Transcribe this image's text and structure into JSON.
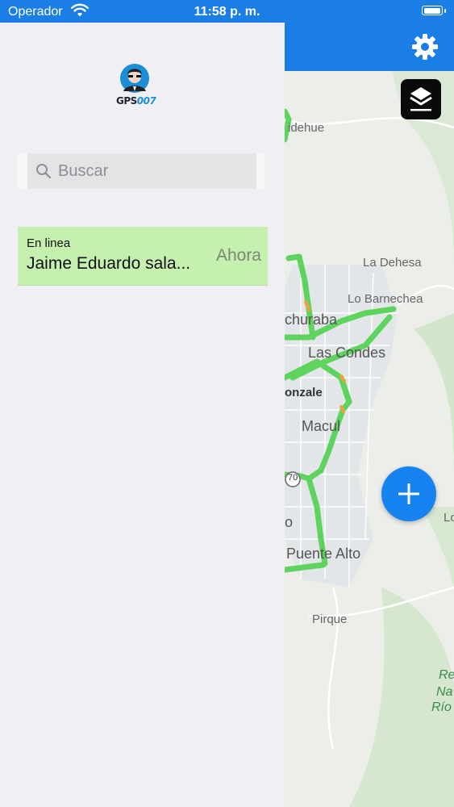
{
  "status_bar": {
    "carrier": "Operador",
    "time": "11:58 p. m.",
    "battery_level": 1.0
  },
  "sidebar": {
    "logo_text": "GPS",
    "logo_number": "007",
    "search": {
      "placeholder": "Buscar",
      "value": ""
    },
    "devices": [
      {
        "status": "En linea",
        "name": "Jaime Eduardo sala...",
        "time": "Ahora"
      }
    ]
  },
  "map": {
    "labels": [
      "idehue",
      "La Dehesa",
      "Lo Barnechea",
      "churaba",
      "Las Condes",
      "onzale",
      "Macul",
      "70",
      "o",
      "Puente Alto",
      "Pirque",
      "Lo",
      "Re",
      "Na",
      "Río"
    ],
    "route_color": "#5ed35e",
    "accent_color": "#1783f0"
  },
  "toolbar": {
    "settings_icon": "gear-icon",
    "layers_icon": "layers-icon",
    "add_icon": "plus-icon"
  }
}
